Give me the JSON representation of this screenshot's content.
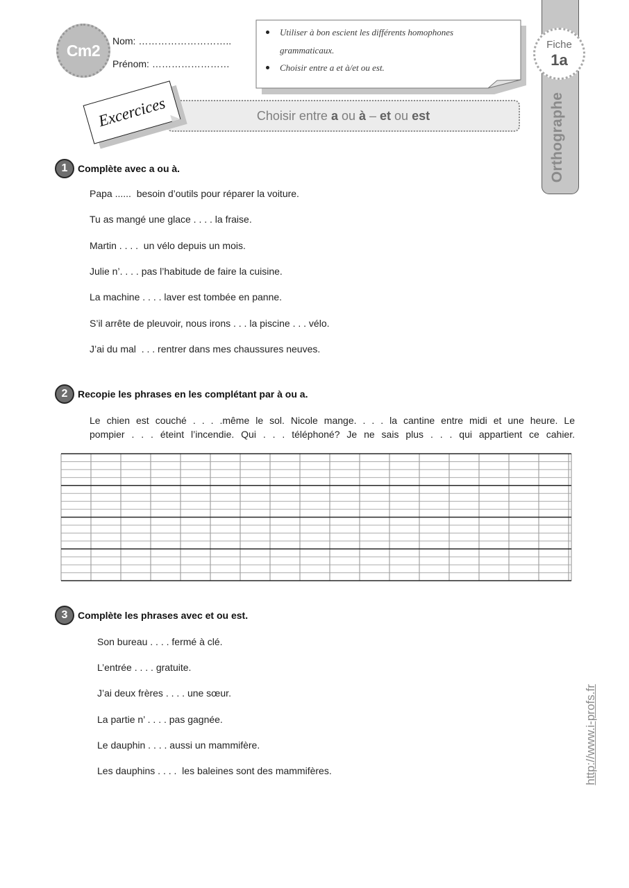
{
  "header": {
    "level_badge": "Cm2",
    "name_field": {
      "label": "Nom: ",
      "blank": "……………………….."
    },
    "firstname_field": {
      "label": "Prénom: ",
      "blank": "……………………"
    }
  },
  "objectives": [
    "Utiliser à bon escient les différents homophones grammaticaux.",
    "Choisir entre a et à/et ou est."
  ],
  "sidebar": {
    "fiche_label": "Fiche",
    "fiche_number": "1a",
    "subject": "Orthographe"
  },
  "banner": {
    "card_label": "Excercices",
    "title_parts": [
      "Choisir entre ",
      "a",
      " ou ",
      "à",
      " – ",
      "et",
      " ou ",
      "est"
    ]
  },
  "exercises": [
    {
      "number": "1",
      "instruction": "Complète avec a ou à.",
      "sentences": [
        "Papa ......  besoin d’outils pour réparer la voiture.",
        "Tu as mangé une glace . . . . la fraise.",
        "Martin . . . .  un vélo depuis un mois.",
        "Julie n’. . . . pas l’habitude de faire la cuisine.",
        "La machine . . . . laver est tombée en panne.",
        "S’il arrête de pleuvoir, nous irons . . . la piscine . . . vélo.",
        "J’ai du mal  . . . rentrer dans mes chaussures neuves."
      ]
    },
    {
      "number": "2",
      "instruction": "Recopie les phrases en les complétant par à ou a.",
      "text_lines": [
        "Le chien est couché . . . .même le sol. Nicole mange. . . . la cantine entre midi et une heure. Le",
        "pompier . . . éteint l’incendie. Qui  . . . téléphoné? Je ne sais  plus  . . .  qui appartient ce cahier."
      ]
    },
    {
      "number": "3",
      "instruction": "Complète les phrases avec et ou est.",
      "sentences": [
        "Son bureau . . . . fermé à clé.",
        "L’entrée . . . . gratuite.",
        "J’ai deux frères . . . . une sœur.",
        "La partie n’ . . . . pas gagnée.",
        "Le dauphin . . . . aussi un mammifère.",
        "Les dauphins . . . .  les baleines sont des mammifères."
      ]
    }
  ],
  "footer": {
    "url": "http://www.i-profs.fr"
  },
  "colors": {
    "badge_gray": "#bdbdbd",
    "tab_gray": "#c6c6c6",
    "number_circle": "#6e6e6e",
    "banner_fill": "#ececec"
  }
}
